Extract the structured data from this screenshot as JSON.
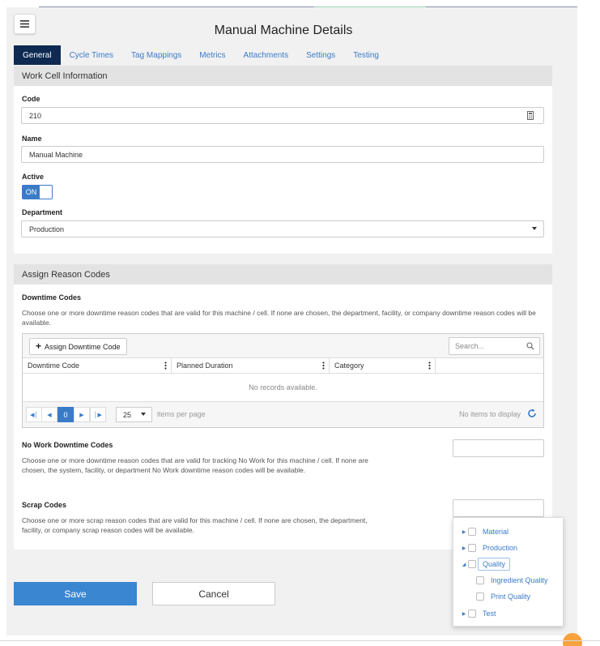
{
  "page": {
    "title": "Manual Machine Details"
  },
  "tabs": [
    {
      "label": "General",
      "active": true
    },
    {
      "label": "Cycle Times"
    },
    {
      "label": "Tag Mappings"
    },
    {
      "label": "Metrics"
    },
    {
      "label": "Attachments"
    },
    {
      "label": "Settings"
    },
    {
      "label": "Testing"
    }
  ],
  "work_cell": {
    "heading": "Work Cell Information",
    "code_label": "Code",
    "code_value": "210",
    "name_label": "Name",
    "name_value": "Manual Machine",
    "active_label": "Active",
    "active_toggle": "ON",
    "department_label": "Department",
    "department_value": "Production"
  },
  "reason_codes": {
    "heading": "Assign Reason Codes",
    "downtime_title": "Downtime Codes",
    "downtime_desc": "Choose one or more downtime reason codes that are valid for this machine / cell. If none are chosen, the department, facility, or company downtime reason codes will be available.",
    "assign_button": "Assign Downtime Code",
    "search_placeholder": "Search...",
    "columns": [
      "Downtime Code",
      "Planned Duration",
      "Category"
    ],
    "empty_text": "No records available.",
    "pager": {
      "current_page": "0",
      "page_size": "25",
      "items_per_page": "items per page",
      "info": "No items to display"
    },
    "nowork_title": "No Work Downtime Codes",
    "nowork_desc": "Choose one or more downtime reason codes that are valid for tracking No Work for this machine / cell. If none are chosen, the system, facility, or department No Work downtime reason codes will be available.",
    "scrap_title": "Scrap Codes",
    "scrap_desc": "Choose one or more scrap reason codes that are valid for this machine / cell. If none are chosen, the department, facility, or company scrap reason codes will be available."
  },
  "scrap_tree": [
    {
      "label": "Material"
    },
    {
      "label": "Production"
    },
    {
      "label": "Quality"
    },
    {
      "label": "Ingredient Quality"
    },
    {
      "label": "Print Quality"
    },
    {
      "label": "Test"
    }
  ],
  "actions": {
    "save": "Save",
    "cancel": "Cancel"
  },
  "colors": {
    "accent": "#3a7bc8",
    "tab_active": "#0e2a52",
    "save": "#3a86d0"
  }
}
